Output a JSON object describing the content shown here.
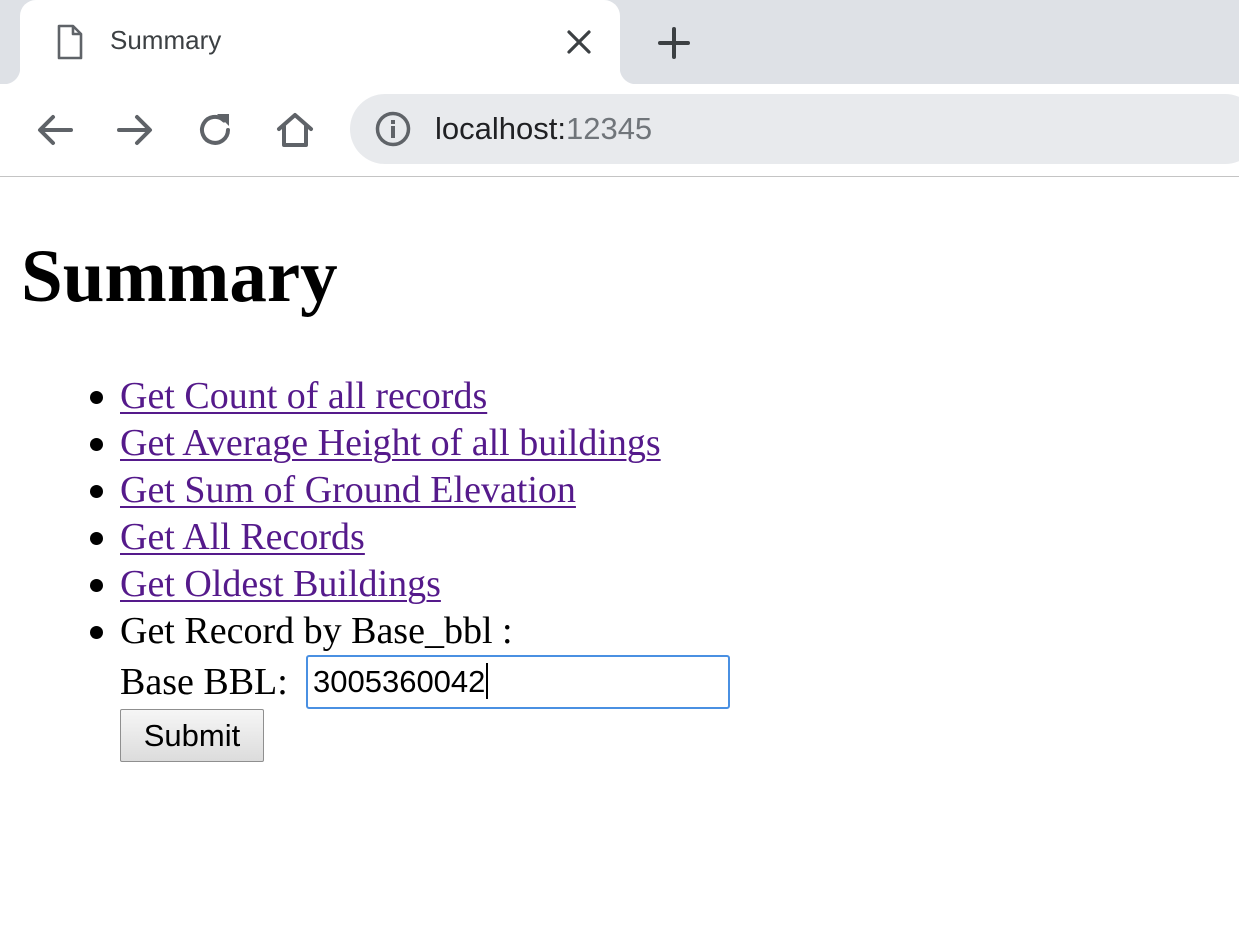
{
  "browser": {
    "tab": {
      "title": "Summary"
    },
    "address_bar": {
      "host": "localhost:",
      "port": "12345"
    }
  },
  "page": {
    "heading": "Summary",
    "links": [
      "Get Count of all records",
      "Get Average Height of all buildings",
      "Get Sum of Ground Elevation",
      "Get All Records",
      "Get Oldest Buildings"
    ],
    "form": {
      "item_label": "Get Record by Base_bbl :",
      "field_label": "Base BBL:",
      "field_value": "3005360042",
      "submit_label": "Submit"
    }
  },
  "colors": {
    "link": "#551a8b",
    "input_focus": "#4a90e2",
    "tabstrip": "#dee1e6",
    "omnibox": "#e8eaed"
  },
  "icons": {
    "favicon": "page-icon",
    "close": "close-icon",
    "new_tab": "plus-icon",
    "back": "arrow-left-icon",
    "forward": "arrow-right-icon",
    "reload": "reload-icon",
    "home": "home-icon",
    "info": "info-icon"
  }
}
